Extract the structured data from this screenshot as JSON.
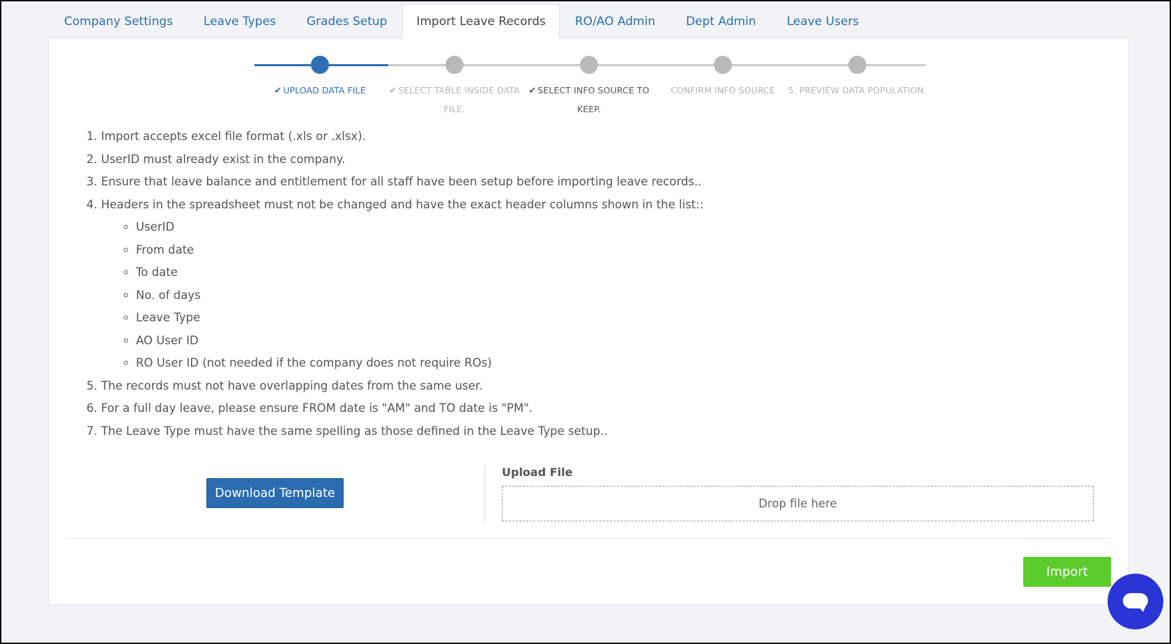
{
  "tabs": [
    {
      "label": "Company Settings"
    },
    {
      "label": "Leave Types"
    },
    {
      "label": "Grades Setup"
    },
    {
      "label": "Import Leave Records"
    },
    {
      "label": "RO/AO Admin"
    },
    {
      "label": "Dept Admin"
    },
    {
      "label": "Leave Users"
    }
  ],
  "active_tab": "Import Leave Records",
  "stepper": {
    "steps": [
      {
        "label": "UPLOAD DATA FILE",
        "check": "✔"
      },
      {
        "label": "SELECT TABLE INSIDE DATA FILE.",
        "check": "✔"
      },
      {
        "label": "SELECT INFO SOURCE TO KEEP.",
        "check": "✔"
      },
      {
        "label": "CONFIRM INFO SOURCE"
      },
      {
        "label": "5. PREVIEW DATA POPULATION."
      }
    ]
  },
  "instructions": {
    "items": [
      "Import accepts excel file format (.xls or .xlsx).",
      "UserID must already exist in the company.",
      "Ensure that leave balance and entitlement for all staff have been setup before importing leave records..",
      "Headers in the spreadsheet must not be changed and have the exact header columns shown in the list::",
      "The records must not have overlapping dates from the same user.",
      "For a full day leave, please ensure FROM date is \"AM\" and TO date is \"PM\".",
      "The Leave Type must have the same spelling as those defined in the Leave Type setup.."
    ],
    "header_columns": [
      "UserID",
      "From date",
      "To date",
      "No. of days",
      "Leave Type",
      "AO User ID",
      "RO User ID (not needed if the company does not require ROs)"
    ]
  },
  "actions": {
    "download_label": "Download Template",
    "upload_label": "Upload File",
    "dropzone_text": "Drop file here",
    "import_label": "Import"
  },
  "colors": {
    "primary": "#2b6cb0",
    "success": "#5ccc2c",
    "chat": "#2a35d6"
  },
  "chat": {
    "icon": "chat-bubble-icon"
  }
}
